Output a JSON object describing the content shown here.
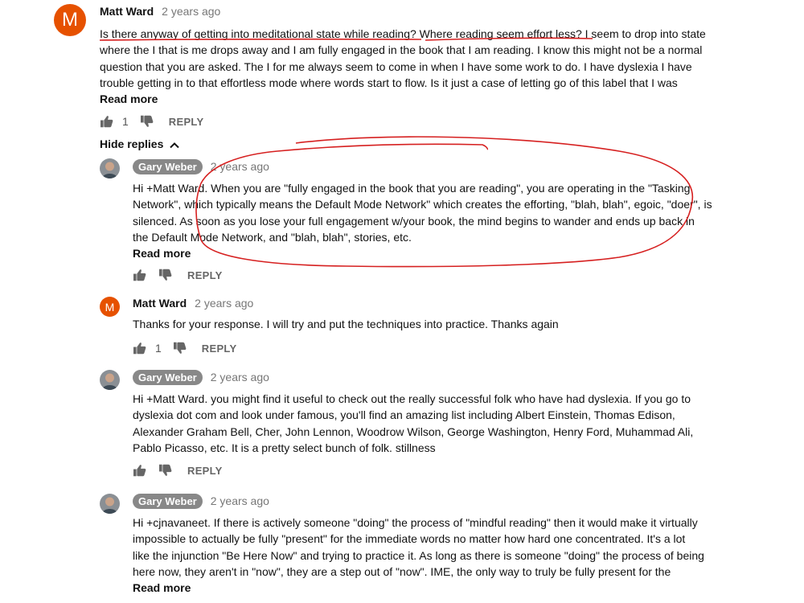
{
  "comments": [
    {
      "author": "Matt Ward",
      "avatar_letter": "M",
      "time": "2 years ago",
      "lines": [
        "Is there anyway of getting into meditational state while reading? Where reading seem effort less? I seem to drop into state",
        "where the I that is me drops away and I am fully engaged in the book that I am reading. I know this might not be a normal",
        "question that you are asked. The I for me always seem to come in when I have some work to do. I have dyslexia I have",
        "trouble getting in to that effortless mode where words start to flow. Is it just a case of letting go of this label that I was"
      ],
      "read_more": "Read more",
      "likes": "1",
      "reply_label": "REPLY"
    }
  ],
  "hide_replies": "Hide replies",
  "replies": [
    {
      "author": "Gary Weber",
      "time": "2 years ago",
      "lines": [
        "Hi +Matt Ward.  When you are \"fully engaged in the book that you are reading\", you are operating in the \"Tasking",
        "Network\", which typically means the Default Mode Network\" which creates the efforting, \"blah, blah\", egoic, \"doer\", is",
        "silenced.  As soon as you lose your full engagement w/your book, the mind begins to wander and ends up back in",
        "the Default Mode Network, and \"blah, blah\", stories, etc."
      ],
      "read_more": "Read more",
      "reply_label": "REPLY"
    },
    {
      "author": "Matt Ward",
      "avatar_letter": "M",
      "time": "2 years ago",
      "lines": [
        "Thanks for your response. I will try and put the  techniques into practice. Thanks again"
      ],
      "likes": "1",
      "reply_label": "REPLY"
    },
    {
      "author": "Gary Weber",
      "time": "2 years ago",
      "lines": [
        "Hi +Matt Ward.  you might find it useful to check out the really successful folk who have had dyslexia.  If you go to",
        "dyslexia dot com and look under famous, you'll find an amazing list including Albert Einstein, Thomas Edison,",
        "Alexander Graham Bell, Cher, John Lennon, Woodrow Wilson, George Washington, Henry Ford, Muhammad Ali,",
        "Pablo Picasso, etc.  It is a pretty select bunch of folk.  stillness"
      ],
      "reply_label": "REPLY"
    },
    {
      "author": "Gary Weber",
      "time": "2 years ago",
      "lines": [
        "Hi +cjnavaneet.  If there is actively someone \"doing\" the process of \"mindful reading\" then it would make it virtually",
        "impossible to actually be fully \"present\" for the immediate words no matter how hard one concentrated.  It's a lot",
        "like the injunction \"Be Here Now\" and trying to practice it.  As long as there is someone \"doing\" the process of being",
        "here now, they aren't in \"now\", they are a step out of \"now\".  IME, the only way to truly be fully present for the"
      ],
      "read_more": "Read more"
    }
  ],
  "colors": {
    "avatar_orange": "#e65100",
    "chip_gray": "#888888",
    "annotation_red": "#d62020"
  },
  "icons": [
    "thumbs-up-icon",
    "thumbs-down-icon",
    "chevron-up-icon"
  ]
}
